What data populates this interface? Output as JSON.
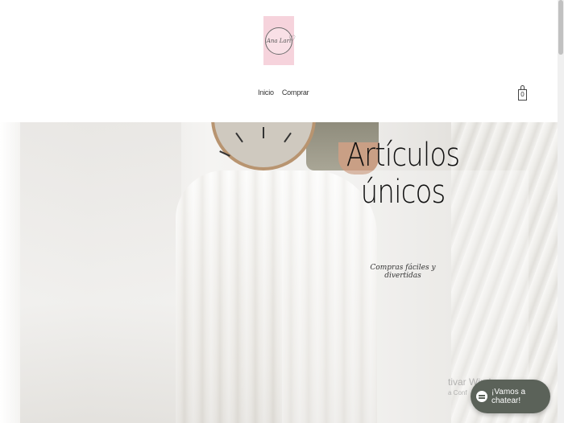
{
  "header": {
    "logo_text": "Ana Lari",
    "logo_bg": "#f6d3dc",
    "nav": [
      {
        "label": "Inicio"
      },
      {
        "label": "Comprar"
      }
    ],
    "cart": {
      "icon": "shopping-bag-icon",
      "count": "0"
    }
  },
  "hero": {
    "title_line1": "Artículos",
    "title_line2": "únicos",
    "subtitle": "Compras fáciles y divertidas"
  },
  "watermark": {
    "title": "tivar Windows",
    "subtitle": "a Conf"
  },
  "chat": {
    "label": "¡Vamos a chatear!",
    "icon": "chat-bubble-icon",
    "bg": "#5b6259"
  }
}
